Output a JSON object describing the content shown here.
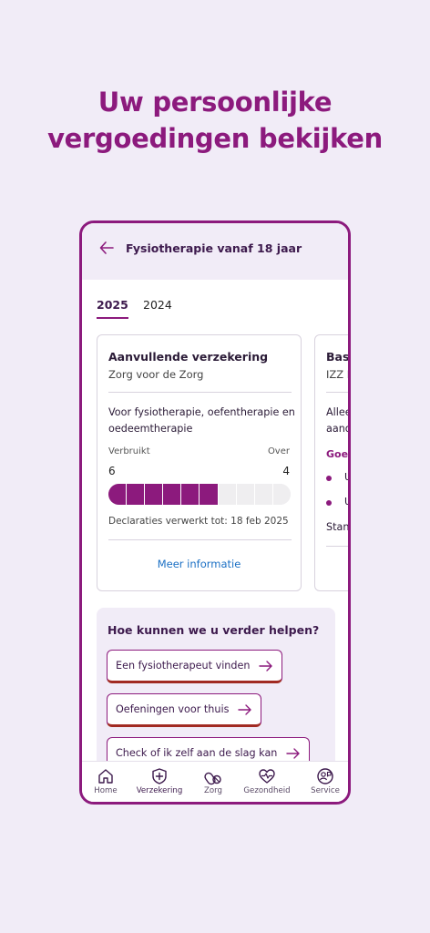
{
  "headline": {
    "line1": "Uw persoonlijke",
    "line2": "vergoedingen bekijken"
  },
  "colors": {
    "accent": "#8c1a7d",
    "link": "#1a6fc4",
    "background": "#f1ecf7"
  },
  "topbar": {
    "back_icon": "back-arrow-icon",
    "title": "Fysiotherapie vanaf 18 jaar"
  },
  "year_tabs": {
    "selected": "2025",
    "other": "2024"
  },
  "card1": {
    "title": "Aanvullende verzekering",
    "subtitle": "Zorg voor de Zorg",
    "description": "Voor fysiotherapie, oefentherapie en oedeemtherapie",
    "used_label": "Verbruikt",
    "over_label": "Over",
    "used_value": "6",
    "over_value": "4",
    "progress": {
      "used": 6,
      "total": 10
    },
    "processed": "Declaraties verwerkt tot: 18 feb 2025",
    "more_info": "Meer informatie"
  },
  "card2": {
    "title": "Basi",
    "subtitle": "IZZ B",
    "line1": "Allee",
    "line2": "aand",
    "link": "Goed",
    "bullet1": "U",
    "bullet2": "U",
    "footer": "Stand"
  },
  "help": {
    "title": "Hoe kunnen we u verder helpen?",
    "buttons": [
      {
        "label": "Een fysiotherapeut vinden"
      },
      {
        "label": "Oefeningen voor thuis"
      },
      {
        "label": "Check of ik zelf aan de slag kan"
      }
    ]
  },
  "nav": {
    "items": [
      {
        "label": "Home",
        "icon": "home-icon"
      },
      {
        "label": "Verzekering",
        "icon": "shield-plus-icon",
        "active": true
      },
      {
        "label": "Zorg",
        "icon": "pills-icon"
      },
      {
        "label": "Gezondheid",
        "icon": "heart-pulse-icon"
      },
      {
        "label": "Service",
        "icon": "chat-person-icon"
      }
    ]
  }
}
